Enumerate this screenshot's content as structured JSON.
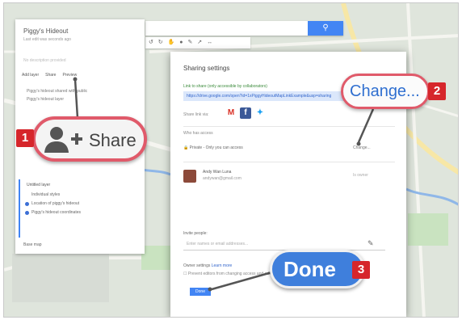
{
  "left_panel": {
    "title": "Piggy's Hideout",
    "subtitle": "Last edit was seconds ago",
    "description_hint": "No description provided",
    "actions": [
      "Add layer",
      "Share",
      "Preview"
    ],
    "items": [
      "Piggy's hideout shared with public",
      "Piggy's hideout layer"
    ],
    "layer_title": "Untitled layer",
    "layer_items": [
      "Individual styles",
      "Location of piggy's hideout",
      "Piggy's hideout coordinates"
    ],
    "basemap": "Base map"
  },
  "map": {
    "search_button": "Search"
  },
  "dialog": {
    "title": "Sharing settings",
    "link_label": "Link to share (only accessible by collaborators)",
    "link_value": "https://drive.google.com/open?id=1xPiggyHideoutMapLinkExample&usp=sharing",
    "share_via": "Share link via:",
    "share_icons": [
      "gmail-icon",
      "facebook-icon",
      "twitter-icon"
    ],
    "access_label": "Who has access",
    "access_value": "Private - Only you can access",
    "access_change": "Change...",
    "owner_name": "Andy Wan Luna",
    "owner_email": "andywan@gmail.com",
    "owner_role": "Is owner",
    "invite_label": "Invite people:",
    "invite_placeholder": "Enter names or email addresses...",
    "owner_settings": "Owner settings",
    "learn_more": "Learn more",
    "prevent_text": "Prevent editors from changing access and adding new people",
    "done_button": "Done"
  },
  "callouts": {
    "share": {
      "number": "1",
      "text": "Share"
    },
    "change": {
      "number": "2",
      "text": "Change..."
    },
    "done": {
      "number": "3",
      "text": "Done"
    }
  },
  "colors": {
    "callout_border": "#e05a6a",
    "badge": "#d6262b",
    "done_blue": "#3f7fdc",
    "link_blue": "#2f6fd0"
  }
}
